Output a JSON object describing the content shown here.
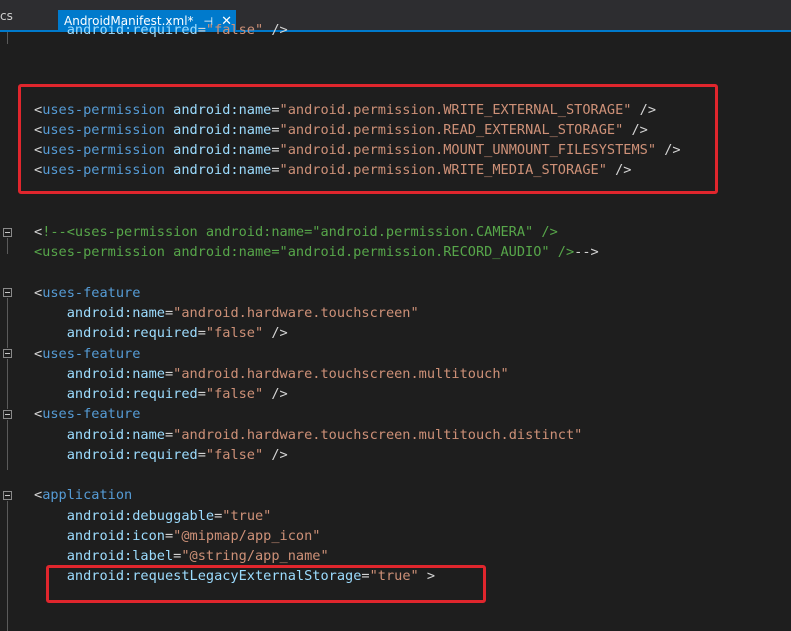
{
  "tabs": {
    "previous_tab_fragment": "cs",
    "active_tab": {
      "label": "AndroidManifest.xml*",
      "pin_glyph": "⊣",
      "close_glyph": "✕"
    }
  },
  "editor": {
    "lines": [
      {
        "indent": "    ",
        "tokens": [
          {
            "t": "attr",
            "v": "android:required"
          },
          {
            "t": "punc",
            "v": "="
          },
          {
            "t": "str",
            "v": "\"false\""
          },
          {
            "t": "punc",
            "v": " />"
          }
        ]
      },
      {
        "indent": "",
        "tokens": []
      },
      {
        "indent": "",
        "tokens": []
      },
      {
        "indent": "",
        "tokens": [
          {
            "t": "punc",
            "v": "<"
          },
          {
            "t": "tag",
            "v": "uses-permission"
          },
          {
            "t": "punc",
            "v": " "
          },
          {
            "t": "attr",
            "v": "android:name"
          },
          {
            "t": "punc",
            "v": "="
          },
          {
            "t": "str",
            "v": "\"android.permission.WRITE_EXTERNAL_STORAGE\""
          },
          {
            "t": "punc",
            "v": " />"
          }
        ]
      },
      {
        "indent": "",
        "tokens": [
          {
            "t": "punc",
            "v": "<"
          },
          {
            "t": "tag",
            "v": "uses-permission"
          },
          {
            "t": "punc",
            "v": " "
          },
          {
            "t": "attr",
            "v": "android:name"
          },
          {
            "t": "punc",
            "v": "="
          },
          {
            "t": "str",
            "v": "\"android.permission.READ_EXTERNAL_STORAGE\""
          },
          {
            "t": "punc",
            "v": " />"
          }
        ]
      },
      {
        "indent": "",
        "tokens": [
          {
            "t": "punc",
            "v": "<"
          },
          {
            "t": "tag",
            "v": "uses-permission"
          },
          {
            "t": "punc",
            "v": " "
          },
          {
            "t": "attr",
            "v": "android:name"
          },
          {
            "t": "punc",
            "v": "="
          },
          {
            "t": "str",
            "v": "\"android.permission.MOUNT_UNMOUNT_FILESYSTEMS\""
          },
          {
            "t": "punc",
            "v": " />"
          }
        ]
      },
      {
        "indent": "",
        "tokens": [
          {
            "t": "punc",
            "v": "<"
          },
          {
            "t": "tag",
            "v": "uses-permission"
          },
          {
            "t": "punc",
            "v": " "
          },
          {
            "t": "attr",
            "v": "android:name"
          },
          {
            "t": "punc",
            "v": "="
          },
          {
            "t": "str",
            "v": "\"android.permission.WRITE_MEDIA_STORAGE\""
          },
          {
            "t": "punc",
            "v": " />"
          }
        ]
      },
      {
        "indent": "",
        "tokens": []
      },
      {
        "indent": "",
        "tokens": [
          {
            "t": "punc",
            "v": "<"
          },
          {
            "t": "comment",
            "v": "!--<uses-permission android:name=\"android.permission.CAMERA\" />"
          }
        ]
      },
      {
        "indent": "",
        "tokens": [
          {
            "t": "comment",
            "v": "<uses-permission android:name=\"android.permission.RECORD_AUDIO\" />"
          },
          {
            "t": "punc",
            "v": "-->"
          }
        ]
      },
      {
        "indent": "",
        "tokens": []
      },
      {
        "indent": "",
        "tokens": [
          {
            "t": "punc",
            "v": "<"
          },
          {
            "t": "tag",
            "v": "uses-feature"
          }
        ]
      },
      {
        "indent": "    ",
        "tokens": [
          {
            "t": "attr",
            "v": "android:name"
          },
          {
            "t": "punc",
            "v": "="
          },
          {
            "t": "str",
            "v": "\"android.hardware.touchscreen\""
          }
        ]
      },
      {
        "indent": "    ",
        "tokens": [
          {
            "t": "attr",
            "v": "android:required"
          },
          {
            "t": "punc",
            "v": "="
          },
          {
            "t": "str",
            "v": "\"false\""
          },
          {
            "t": "punc",
            "v": " />"
          }
        ]
      },
      {
        "indent": "",
        "tokens": [
          {
            "t": "punc",
            "v": "<"
          },
          {
            "t": "tag",
            "v": "uses-feature"
          }
        ]
      },
      {
        "indent": "    ",
        "tokens": [
          {
            "t": "attr",
            "v": "android:name"
          },
          {
            "t": "punc",
            "v": "="
          },
          {
            "t": "str",
            "v": "\"android.hardware.touchscreen.multitouch\""
          }
        ]
      },
      {
        "indent": "    ",
        "tokens": [
          {
            "t": "attr",
            "v": "android:required"
          },
          {
            "t": "punc",
            "v": "="
          },
          {
            "t": "str",
            "v": "\"false\""
          },
          {
            "t": "punc",
            "v": " />"
          }
        ]
      },
      {
        "indent": "",
        "tokens": [
          {
            "t": "punc",
            "v": "<"
          },
          {
            "t": "tag",
            "v": "uses-feature"
          }
        ]
      },
      {
        "indent": "    ",
        "tokens": [
          {
            "t": "attr",
            "v": "android:name"
          },
          {
            "t": "punc",
            "v": "="
          },
          {
            "t": "str",
            "v": "\"android.hardware.touchscreen.multitouch.distinct\""
          }
        ]
      },
      {
        "indent": "    ",
        "tokens": [
          {
            "t": "attr",
            "v": "android:required"
          },
          {
            "t": "punc",
            "v": "="
          },
          {
            "t": "str",
            "v": "\"false\""
          },
          {
            "t": "punc",
            "v": " />"
          }
        ]
      },
      {
        "indent": "",
        "tokens": []
      },
      {
        "indent": "",
        "tokens": [
          {
            "t": "punc",
            "v": "<"
          },
          {
            "t": "tag",
            "v": "application"
          }
        ]
      },
      {
        "indent": "    ",
        "tokens": [
          {
            "t": "attr",
            "v": "android:debuggable"
          },
          {
            "t": "punc",
            "v": "="
          },
          {
            "t": "str",
            "v": "\"true\""
          }
        ]
      },
      {
        "indent": "    ",
        "tokens": [
          {
            "t": "attr",
            "v": "android:icon"
          },
          {
            "t": "punc",
            "v": "="
          },
          {
            "t": "str",
            "v": "\"@mipmap/app_icon\""
          }
        ]
      },
      {
        "indent": "    ",
        "tokens": [
          {
            "t": "attr",
            "v": "android:label"
          },
          {
            "t": "punc",
            "v": "="
          },
          {
            "t": "str",
            "v": "\"@string/app_name\""
          }
        ]
      },
      {
        "indent": "    ",
        "tokens": [
          {
            "t": "attr",
            "v": "android:requestLegacyExternalStorage"
          },
          {
            "t": "punc",
            "v": "="
          },
          {
            "t": "str",
            "v": "\"true\""
          },
          {
            "t": "punc",
            "v": " >"
          }
        ]
      }
    ]
  },
  "colors": {
    "background": "#1e1e1e",
    "tab_active": "#007acc",
    "tag": "#569cd6",
    "attribute": "#9cdcfe",
    "string": "#ce9178",
    "comment": "#57a64a",
    "highlight_border": "#e0262d"
  }
}
